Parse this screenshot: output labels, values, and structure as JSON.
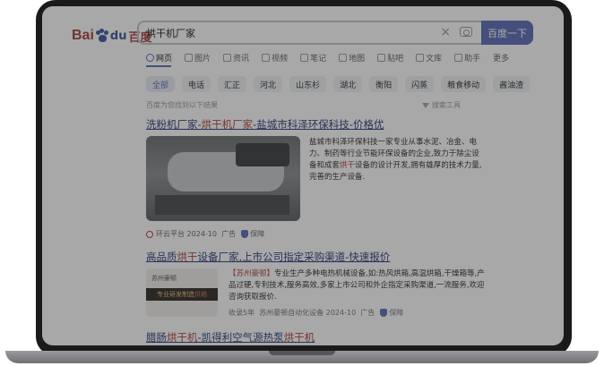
{
  "logo": {
    "text_left": "Bai",
    "text_du": "du",
    "text_right": "百度"
  },
  "search": {
    "query": "烘干机厂家",
    "button_label": "百度一下"
  },
  "tabs": [
    "网页",
    "图片",
    "资讯",
    "视频",
    "笔记",
    "地图",
    "贴吧",
    "文库",
    "助手",
    "更多"
  ],
  "chips": [
    "全部",
    "电话",
    "汇正",
    "河北",
    "山东杉",
    "湖北",
    "衡阳",
    "闪蒸",
    "粮食移动",
    "酱油渣"
  ],
  "hint": "百度为您找到以下结果",
  "tools_label": "搜索工具",
  "results": [
    {
      "title_a": "洗粉机厂家-",
      "title_hl": "烘干机厂家",
      "title_b": "-盐城市科泽环保科技-价格优",
      "desc_a": "盐城市科泽环保科技一家专业从事水泥、冶金、电力、制药等行业节能环保设备的企业,致力于除尘设备和成套",
      "desc_hl": "烘干",
      "desc_b": "设备的设计开发,拥有雄厚的技术力量,完善的生产设备.",
      "source": "环云平台",
      "date": "2024-10",
      "ad": "广告",
      "badge": "保障"
    },
    {
      "title_a": "高品质",
      "title_hl": "烘干",
      "title_b": "设备厂家,上市公司指定采购渠道-快速报价",
      "brand": "【苏州豪顿】",
      "desc": "专业生产多种电热机械设备,如:热风烘箱,高温烘箱,干燥箱等,产品过硬,专利技术,服务高效,多家上市公司和外企指定采购渠道,一流服务,欢迎咨询获取报价.",
      "image_top": "苏州豪顿",
      "image_band_a": "专业研发制造",
      "image_band_hl": "烘箱",
      "meta_a": "收录5年",
      "meta_company": "苏州豪顿自动化设备",
      "date": "2024-10",
      "ad": "广告",
      "badge": "保障"
    },
    {
      "title_a": "腊肠",
      "title_hl": "烘干机",
      "title_b": "-凯得利空气源热泵",
      "title_hl2": "烘干机"
    }
  ],
  "colors": {
    "accent": "#4e6ef2",
    "link": "#2440b3",
    "highlight": "#f73131"
  }
}
